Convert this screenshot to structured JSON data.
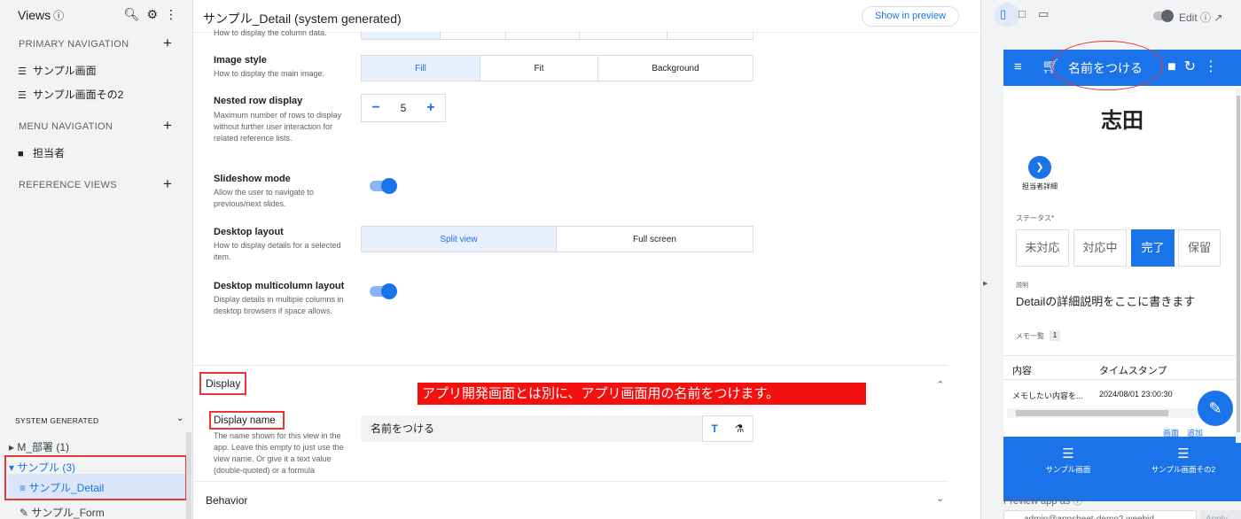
{
  "sidebar": {
    "title": "Views",
    "info_icon": "ⓘ",
    "tools": [
      "search-icon",
      "gear-icon",
      "more-vert-icon"
    ],
    "sections": [
      {
        "label": "PRIMARY NAVIGATION",
        "items": [
          "サンプル画面",
          "サンプル画面その2"
        ]
      },
      {
        "label": "MENU NAVIGATION",
        "items": [
          "担当者"
        ]
      },
      {
        "label": "REFERENCE VIEWS",
        "items": []
      }
    ],
    "system_generated": {
      "label": "SYSTEM GENERATED",
      "tree": [
        "M_部署 (1)",
        "サンプル (3)",
        "サンプル_Detail",
        "サンプル_Form"
      ]
    }
  },
  "center": {
    "title": "サンプル_Detail (system generated)",
    "preview_button": "Show in preview",
    "cut_desc": "How to display the column data.",
    "image_style": {
      "label": "Image style",
      "desc": "How to display the main image.",
      "options": [
        "Fill",
        "Fit",
        "Background"
      ],
      "selected": "Fill"
    },
    "nested_rows": {
      "label": "Nested row display",
      "desc": "Maximum number of rows to display without further user interaction for related reference lists.",
      "value": "5"
    },
    "slideshow": {
      "label": "Slideshow mode",
      "desc": "Allow the user to navigate to previous/next slides.",
      "on": true
    },
    "desktop_layout": {
      "label": "Desktop layout",
      "desc": "How to display details for a selected item.",
      "options": [
        "Split view",
        "Full screen"
      ],
      "selected": "Split view"
    },
    "multicolumn": {
      "label": "Desktop multicolumn layout",
      "desc": "Display details in multiple columns in desktop browsers if space allows.",
      "on": true
    },
    "display_section": "Display",
    "annotation": "アプリ開発画面とは別に、アプリ画面用の名前をつけます。",
    "display_name": {
      "label": "Display name",
      "desc": "The name shown for this view in the app. Leave this empty to just use the view name. Or give it a text value (double-quoted) or a formula",
      "value": "名前をつける"
    },
    "behavior_section": "Behavior"
  },
  "preview": {
    "edit_label": "Edit ⓘ",
    "app_title": "名前をつける",
    "record_title": "志田",
    "action_label": "担当者詳細",
    "status_label": "ステータス*",
    "status_options": [
      "未対応",
      "対応中",
      "完了",
      "保留"
    ],
    "status_selected": "完了",
    "desc_label": "説明",
    "desc_value": "Detailの詳細説明をここに書きます",
    "memo_label": "メモ一覧",
    "memo_count": "1",
    "table_headers": [
      "内容",
      "タイムスタンプ"
    ],
    "table_row": [
      "メモしたい内容を...",
      "2024/08/01 23:00:30"
    ],
    "peek_text": "画面　追加",
    "nav_items": [
      "サンプル画面",
      "サンプル画面その2"
    ],
    "preview_as_label": "Preview app as",
    "preview_as_value": "admin@appsheet-demo2.weebid",
    "apply_label": "Apply"
  },
  "colors": {
    "accent": "#1a73e8",
    "annotation": "#f51010",
    "highlight": "#e53935"
  }
}
